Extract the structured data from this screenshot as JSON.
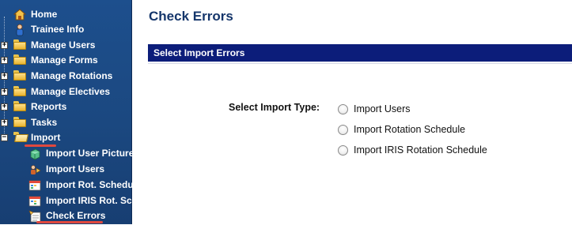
{
  "sidebar": {
    "items": [
      {
        "label": "Home",
        "icon": "home-icon",
        "expander": ""
      },
      {
        "label": "Trainee Info",
        "icon": "user-icon",
        "expander": ""
      },
      {
        "label": "Manage Users",
        "icon": "folder-icon",
        "expander": "+"
      },
      {
        "label": "Manage Forms",
        "icon": "folder-icon",
        "expander": "+"
      },
      {
        "label": "Manage Rotations",
        "icon": "folder-icon",
        "expander": "+"
      },
      {
        "label": "Manage Electives",
        "icon": "folder-icon",
        "expander": "+"
      },
      {
        "label": "Reports",
        "icon": "folder-icon",
        "expander": "+"
      },
      {
        "label": "Tasks",
        "icon": "folder-icon",
        "expander": "+"
      },
      {
        "label": "Import",
        "icon": "open-folder-icon",
        "expander": "−"
      }
    ],
    "sub_items": [
      {
        "label": "Import User Picture",
        "icon": "picture-import-icon"
      },
      {
        "label": "Import Users",
        "icon": "users-import-icon"
      },
      {
        "label": "Import Rot. Schedule",
        "icon": "schedule-import-icon"
      },
      {
        "label": "Import IRIS Rot. Sch",
        "icon": "iris-schedule-import-icon"
      },
      {
        "label": "Check Errors",
        "icon": "check-errors-icon"
      }
    ],
    "highlighted": [
      "Import",
      "Check Errors"
    ]
  },
  "main": {
    "title": "Check Errors",
    "section_header": "Select Import Errors",
    "import_type_label": "Select Import Type:",
    "options": [
      "Import Users",
      "Import Rotation Schedule",
      "Import IRIS Rotation Schedule"
    ]
  },
  "colors": {
    "sidebar_bg": "#1b4880",
    "section_bar": "#0c1d7a",
    "title": "#15366b",
    "highlight_underline": "#e0483e"
  }
}
